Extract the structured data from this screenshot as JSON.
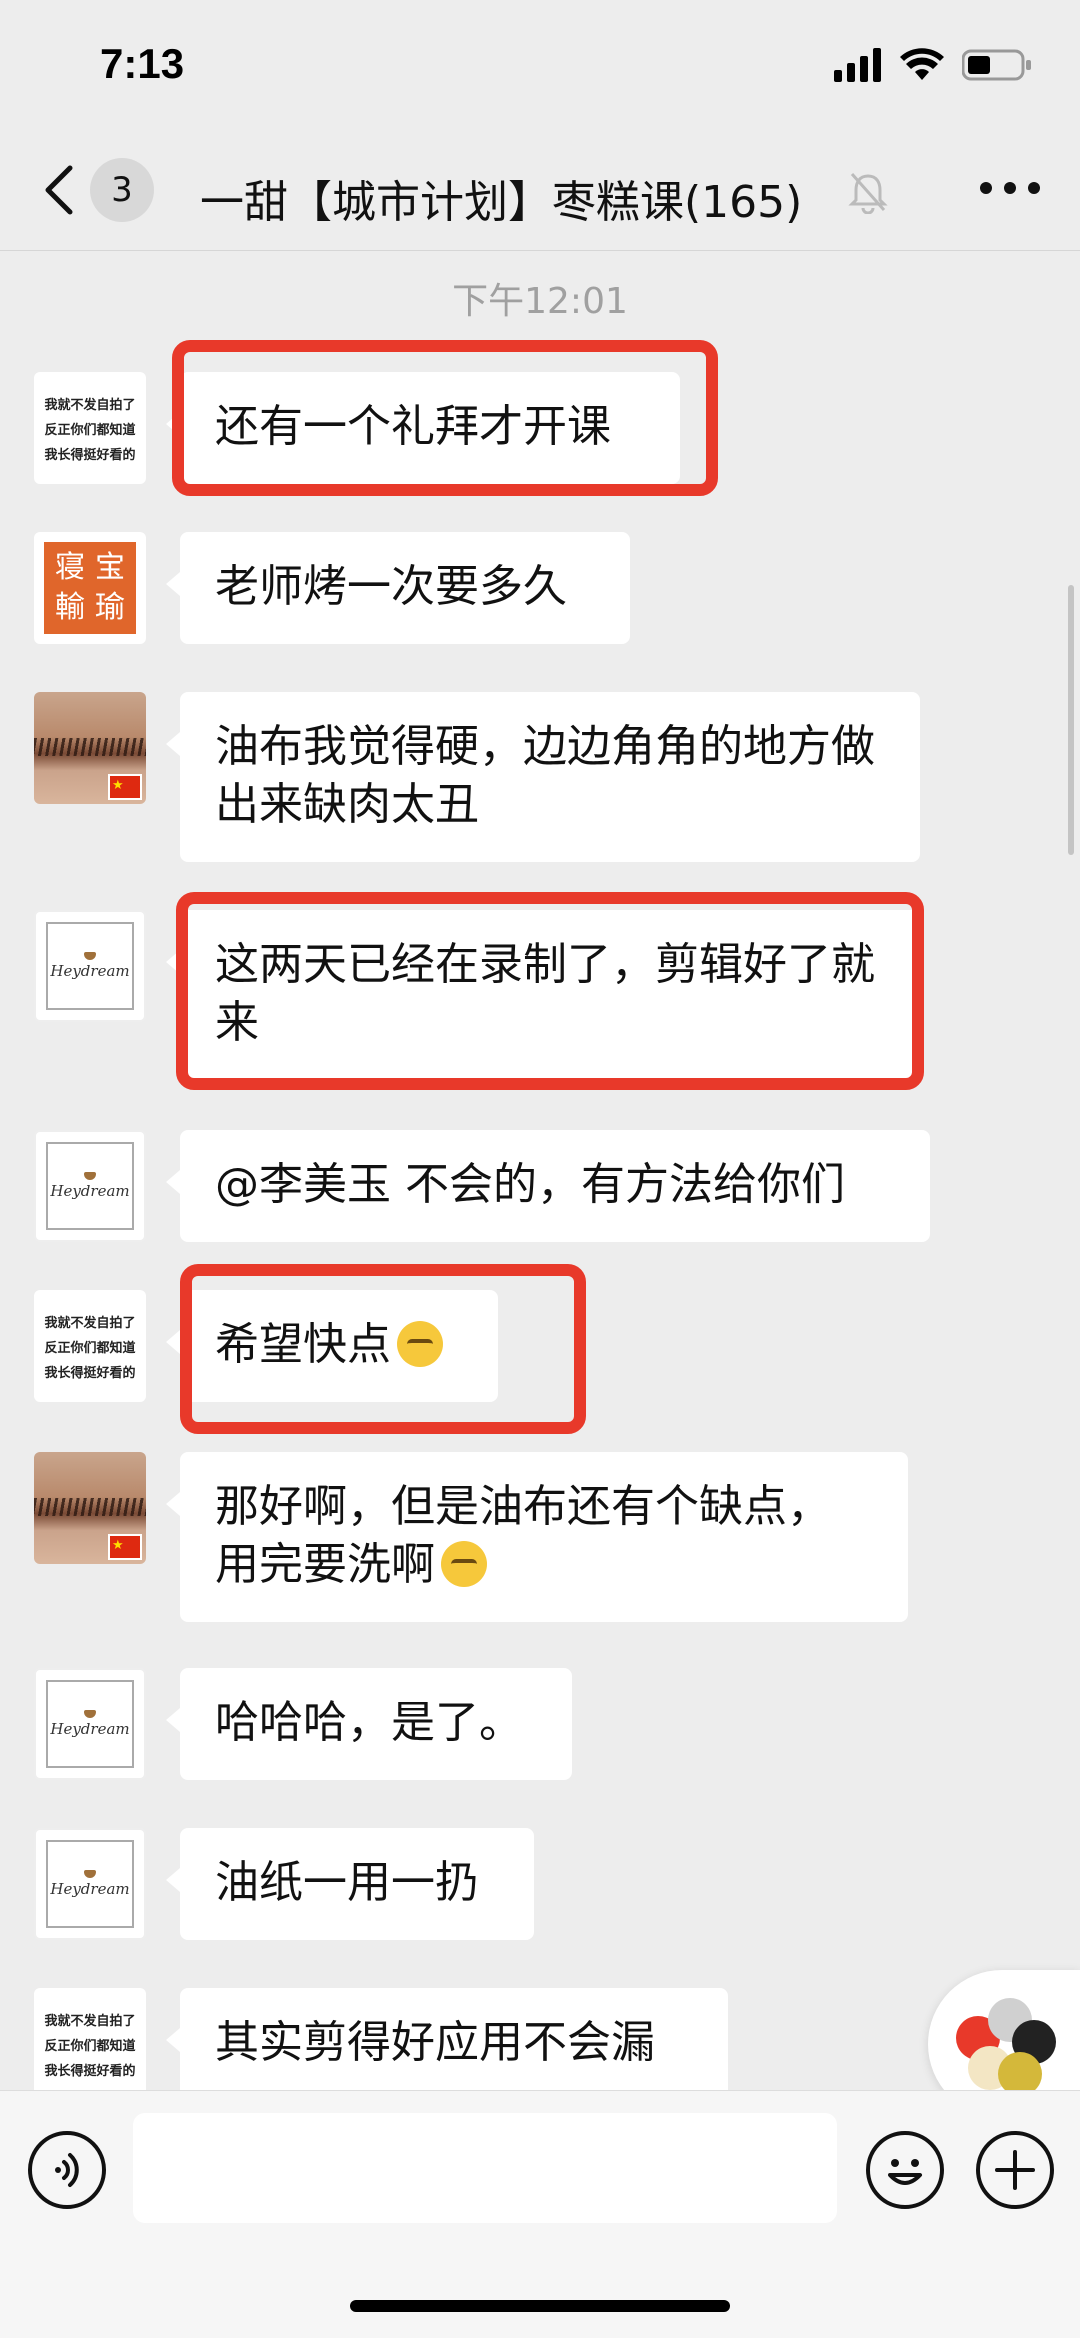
{
  "status_bar": {
    "time": "7:13"
  },
  "nav": {
    "unread_count": "3",
    "title": "一甜【城市计划】枣糕课(165)"
  },
  "timestamp": "下午12:01",
  "avatars": {
    "text_avatar_lines": [
      "我就不发自拍了",
      "反正你们都知道",
      "我长得挺好看的"
    ],
    "stamp_chars": [
      "寝",
      "宝",
      "輸",
      "瑜"
    ],
    "logo_text": "Heydream"
  },
  "messages": [
    {
      "text": "还有一个礼拜才开课"
    },
    {
      "text": "老师烤一次要多久"
    },
    {
      "text": "油布我觉得硬，边边角角的地方做出来缺肉太丑"
    },
    {
      "text": "这两天已经在录制了，剪辑好了就来"
    },
    {
      "text": "@李美玉 不会的，有方法给你们"
    },
    {
      "text": "希望快点"
    },
    {
      "text": "那好啊，但是油布还有个缺点，用完要洗啊"
    },
    {
      "text": "哈哈哈，是了。"
    },
    {
      "text": "油纸一用一扔"
    },
    {
      "text": "其实剪得好应用不会漏"
    }
  ],
  "colors": {
    "highlight": "#e8392a",
    "background": "#ededed",
    "bubble": "#ffffff"
  },
  "icons": [
    "back-chevron-icon",
    "mute-bell-icon",
    "more-icon",
    "voice-icon",
    "emoji-icon",
    "plus-icon",
    "ball-icon"
  ]
}
